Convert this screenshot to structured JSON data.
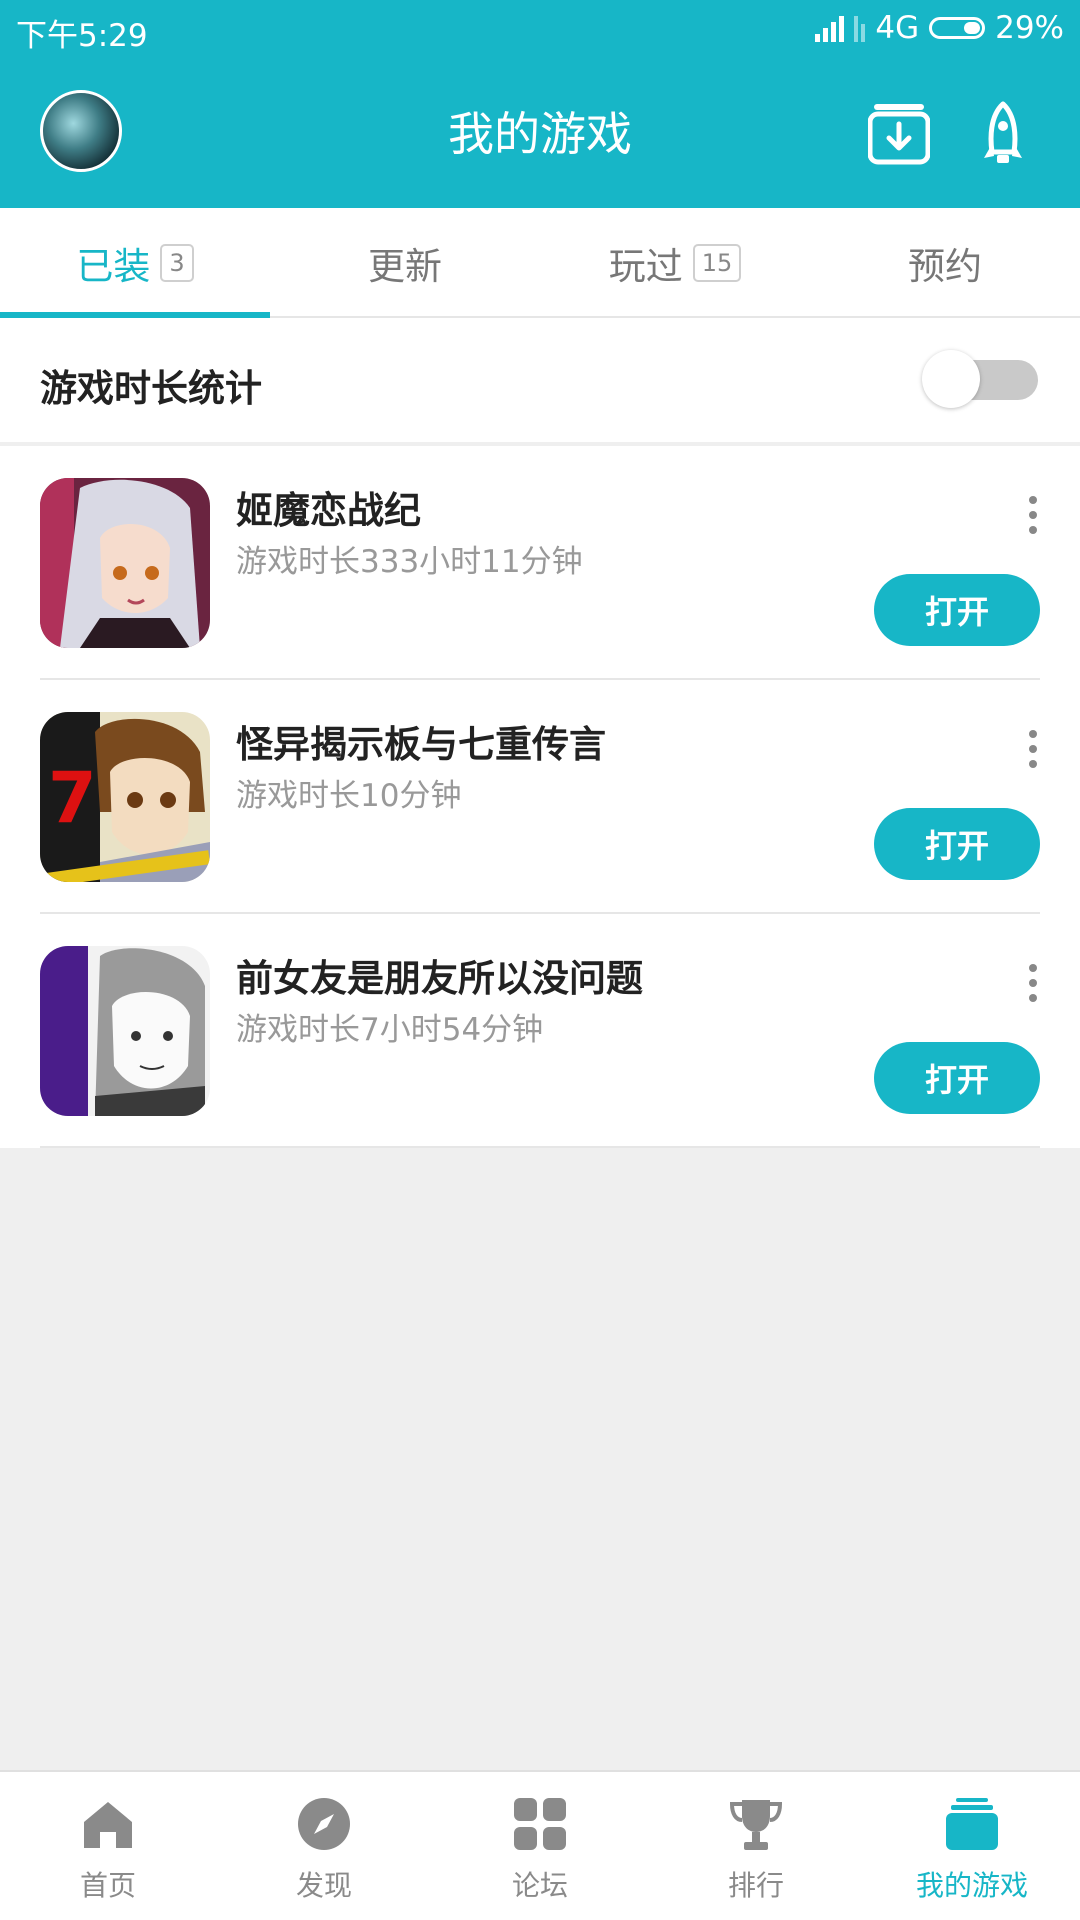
{
  "status_bar": {
    "time": "下午5:29",
    "network": "4G",
    "battery": "29%"
  },
  "header": {
    "title": "我的游戏"
  },
  "tabs": [
    {
      "label": "已装",
      "badge": "3"
    },
    {
      "label": "更新",
      "badge": ""
    },
    {
      "label": "玩过",
      "badge": "15"
    },
    {
      "label": "预约",
      "badge": ""
    }
  ],
  "stats": {
    "label": "游戏时长统计",
    "enabled": false
  },
  "games": [
    {
      "name": "姬魔恋战纪",
      "playtime": "游戏时长333小时11分钟",
      "button": "打开"
    },
    {
      "name": "怪异揭示板与七重传言",
      "playtime": "游戏时长10分钟",
      "button": "打开"
    },
    {
      "name": "前女友是朋友所以没问题",
      "playtime": "游戏时长7小时54分钟",
      "button": "打开"
    }
  ],
  "bottom_nav": [
    {
      "label": "首页",
      "icon": "home-icon"
    },
    {
      "label": "发现",
      "icon": "compass-icon"
    },
    {
      "label": "论坛",
      "icon": "grid-icon"
    },
    {
      "label": "排行",
      "icon": "trophy-icon"
    },
    {
      "label": "我的游戏",
      "icon": "stack-icon"
    }
  ],
  "colors": {
    "accent": "#17b6c7",
    "background": "#efefef"
  }
}
